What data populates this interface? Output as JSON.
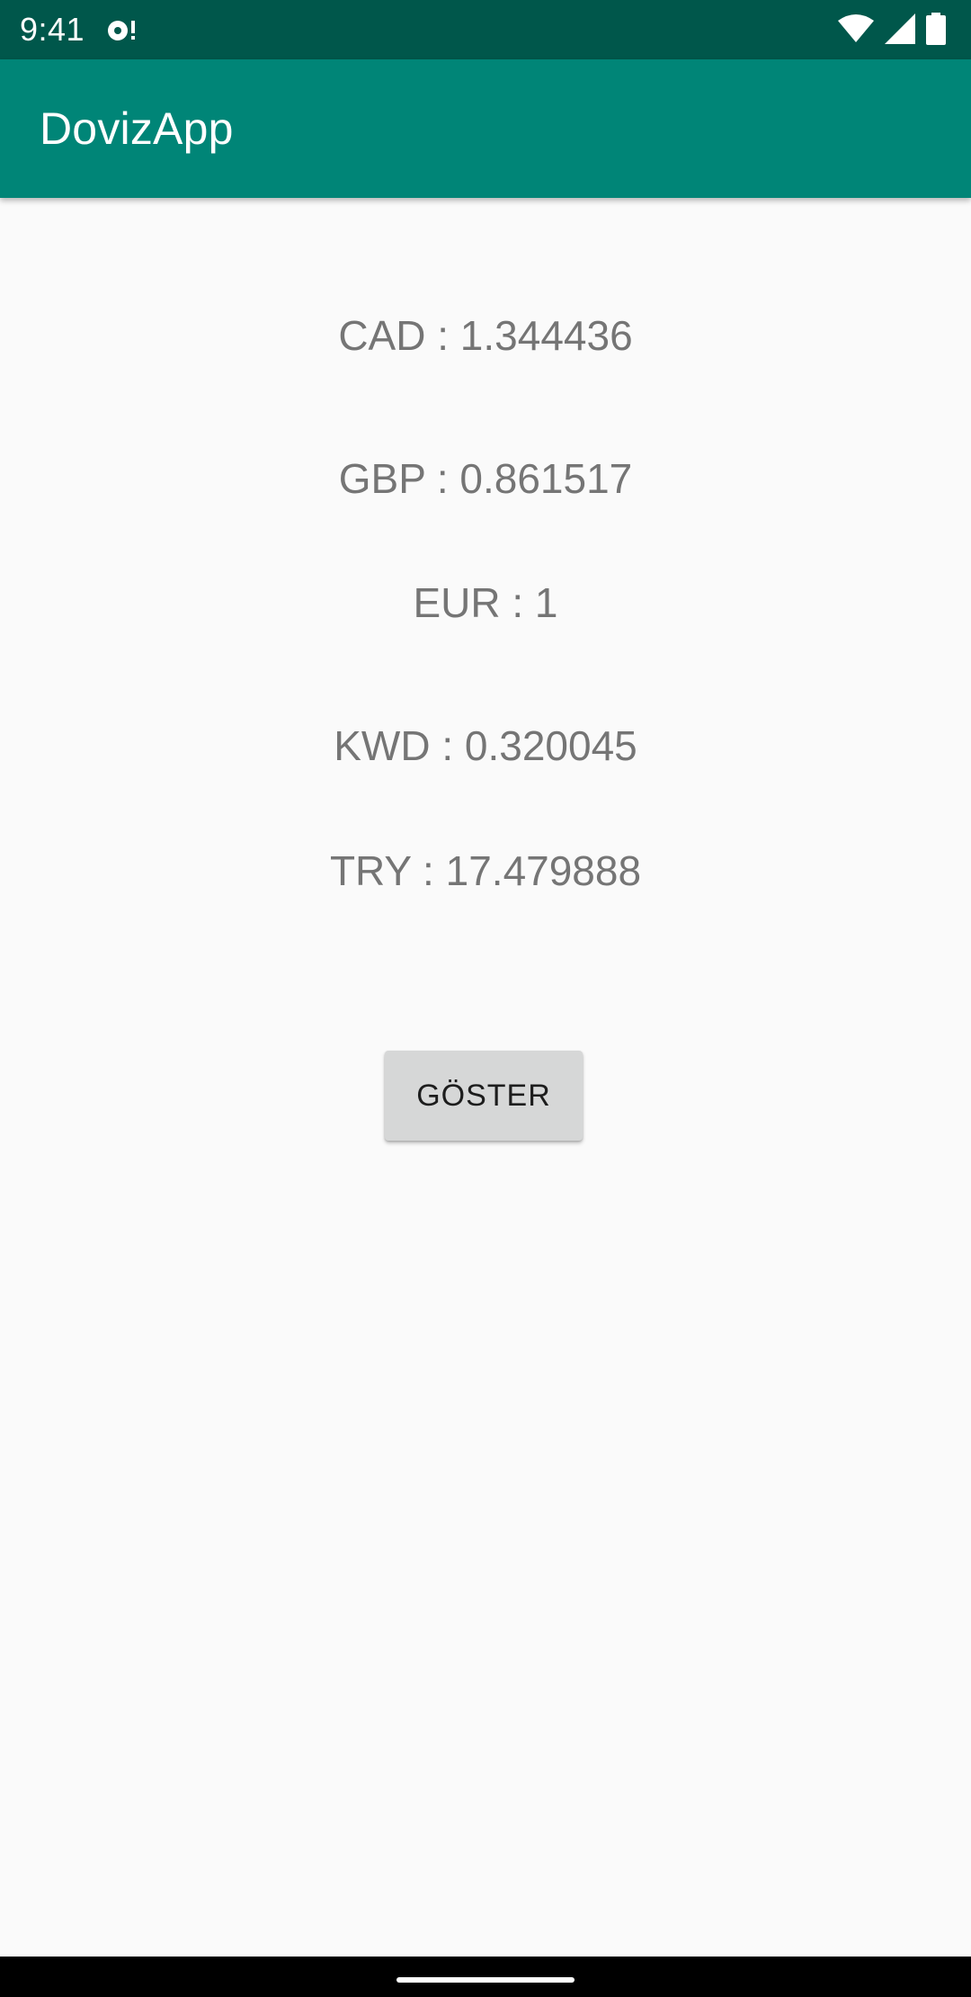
{
  "status_bar": {
    "time": "9:41",
    "icons": [
      "notification-icon",
      "wifi-icon",
      "signal-icon",
      "battery-icon"
    ]
  },
  "app_bar": {
    "title": "DovizApp",
    "color": "#008577"
  },
  "rates": [
    {
      "label": "CAD : 1.344436"
    },
    {
      "label": "GBP : 0.861517"
    },
    {
      "label": "EUR : 1"
    },
    {
      "label": "KWD : 0.320045"
    },
    {
      "label": "TRY : 17.479888"
    }
  ],
  "show_button": {
    "label": "GÖSTER"
  },
  "colors": {
    "status_bar": "#00574b",
    "app_bar": "#008577",
    "background": "#fafafa",
    "rate_text": "#757575",
    "button": "#d6d7d7"
  }
}
